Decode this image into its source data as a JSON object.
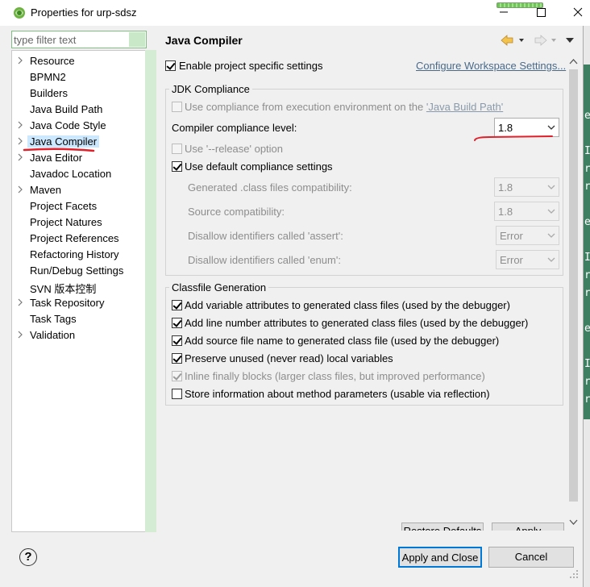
{
  "window": {
    "title": "Properties for urp-sdsz",
    "icons": {
      "app": "eclipse-icon",
      "minimize": "minimize-icon",
      "maximize": "maximize-icon",
      "close": "close-icon"
    }
  },
  "filter": {
    "placeholder": "type filter text",
    "value": ""
  },
  "tree": {
    "items": [
      {
        "label": "Resource",
        "expandable": true
      },
      {
        "label": "BPMN2",
        "expandable": false
      },
      {
        "label": "Builders",
        "expandable": false
      },
      {
        "label": "Java Build Path",
        "expandable": false
      },
      {
        "label": "Java Code Style",
        "expandable": true
      },
      {
        "label": "Java Compiler",
        "expandable": true,
        "selected": true
      },
      {
        "label": "Java Editor",
        "expandable": true
      },
      {
        "label": "Javadoc Location",
        "expandable": false
      },
      {
        "label": "Maven",
        "expandable": true
      },
      {
        "label": "Project Facets",
        "expandable": false
      },
      {
        "label": "Project Natures",
        "expandable": false
      },
      {
        "label": "Project References",
        "expandable": false
      },
      {
        "label": "Refactoring History",
        "expandable": false
      },
      {
        "label": "Run/Debug Settings",
        "expandable": false
      },
      {
        "label": "SVN 版本控制",
        "expandable": false
      },
      {
        "label": "Task Repository",
        "expandable": true
      },
      {
        "label": "Task Tags",
        "expandable": false
      },
      {
        "label": "Validation",
        "expandable": true
      }
    ]
  },
  "page": {
    "title": "Java Compiler",
    "enable_specific": {
      "label": "Enable project specific settings",
      "checked": true
    },
    "configure_link": "Configure Workspace Settings...",
    "jdk": {
      "group_title": "JDK Compliance",
      "use_exec_env_prefix": "Use compliance from execution environment on the ",
      "use_exec_env_link": "'Java Build Path'",
      "compliance_label": "Compiler compliance level:",
      "compliance_value": "1.8",
      "release_option": "Use '--release' option",
      "use_default": "Use default compliance settings",
      "generated_label": "Generated .class files compatibility:",
      "generated_value": "1.8",
      "source_label": "Source compatibility:",
      "source_value": "1.8",
      "assert_label": "Disallow identifiers called 'assert':",
      "assert_value": "Error",
      "enum_label": "Disallow identifiers called 'enum':",
      "enum_value": "Error"
    },
    "classfile": {
      "group_title": "Classfile Generation",
      "options": [
        {
          "label": "Add variable attributes to generated class files (used by the debugger)",
          "checked": true,
          "disabled": false
        },
        {
          "label": "Add line number attributes to generated class files (used by the debugger)",
          "checked": true,
          "disabled": false
        },
        {
          "label": "Add source file name to generated class file (used by the debugger)",
          "checked": true,
          "disabled": false
        },
        {
          "label": "Preserve unused (never read) local variables",
          "checked": true,
          "disabled": false
        },
        {
          "label": "Inline finally blocks (larger class files, but improved performance)",
          "checked": true,
          "disabled": true
        },
        {
          "label": "Store information about method parameters (usable via reflection)",
          "checked": false,
          "disabled": false
        }
      ]
    }
  },
  "buttons": {
    "restore_defaults": "Restore Defaults",
    "apply": "Apply",
    "apply_close": "Apply and Close",
    "cancel": "Cancel",
    "help": "?"
  },
  "background": {
    "chars": [
      "e",
      "I",
      "r",
      "r",
      "e",
      "I",
      "r",
      "r",
      "e",
      "I",
      "r",
      "r"
    ]
  },
  "colors": {
    "selection": "#cce8ff",
    "accent": "#0078d7",
    "editor_green": "#3f7f61",
    "annotation_red": "#e0202a"
  }
}
